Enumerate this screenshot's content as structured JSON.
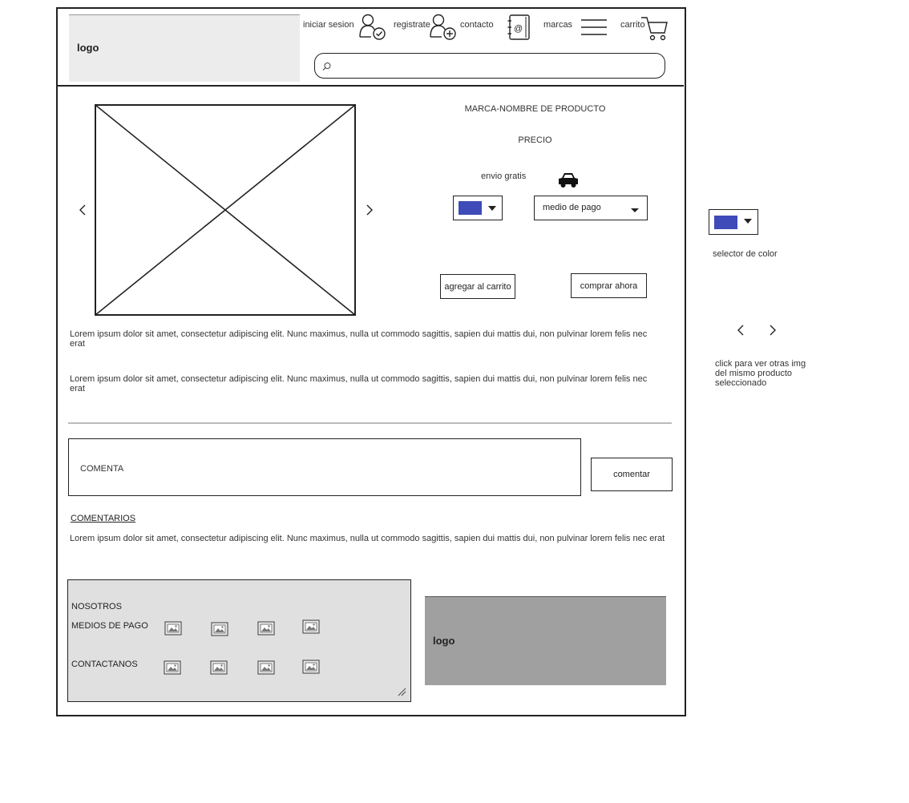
{
  "header": {
    "logo": "logo",
    "nav": {
      "login": "iniciar sesion",
      "register": "registrate",
      "contact": "contacto",
      "brands": "marcas",
      "cart": "carrito"
    },
    "search_placeholder": ""
  },
  "product": {
    "title": "MARCA-NOMBRE DE PRODUCTO",
    "price": "PRECIO",
    "shipping": "envio gratis",
    "color_swatch": "#3e4bb8",
    "payment_select": "medio de pago",
    "add_to_cart": "agregar al carrito",
    "buy_now": "comprar ahora",
    "description_1": "Lorem ipsum dolor sit amet, consectetur adipiscing elit. Nunc maximus, nulla ut commodo sagittis, sapien dui mattis dui, non pulvinar lorem felis nec erat",
    "description_2": "Lorem ipsum dolor sit amet, consectetur adipiscing elit. Nunc maximus, nulla ut commodo sagittis, sapien dui mattis dui, non pulvinar lorem felis nec erat"
  },
  "comments": {
    "input_placeholder": "COMENTA",
    "submit": "comentar",
    "heading": "COMENTARIOS",
    "items": [
      "Lorem ipsum dolor sit amet, consectetur adipiscing elit. Nunc maximus, nulla ut commodo sagittis, sapien dui mattis dui, non pulvinar lorem felis nec erat"
    ]
  },
  "footer": {
    "about": "NOSOTROS",
    "payment_methods": "MEDIOS DE PAGO",
    "contact_us": "CONTACTANOS",
    "logo": "logo"
  },
  "annotations": {
    "color_selector": "selector de color",
    "gallery_note": "click para ver otras img del mismo producto seleccionado"
  },
  "icons": {
    "login": "user-check-icon",
    "register": "user-add-icon",
    "contact": "address-book-icon",
    "brands": "hamburger-menu-icon",
    "cart": "shopping-cart-icon",
    "search": "search-icon",
    "shipping": "car-icon",
    "prev": "chevron-left-icon",
    "next": "chevron-right-icon",
    "footer_images": "image-icon"
  }
}
